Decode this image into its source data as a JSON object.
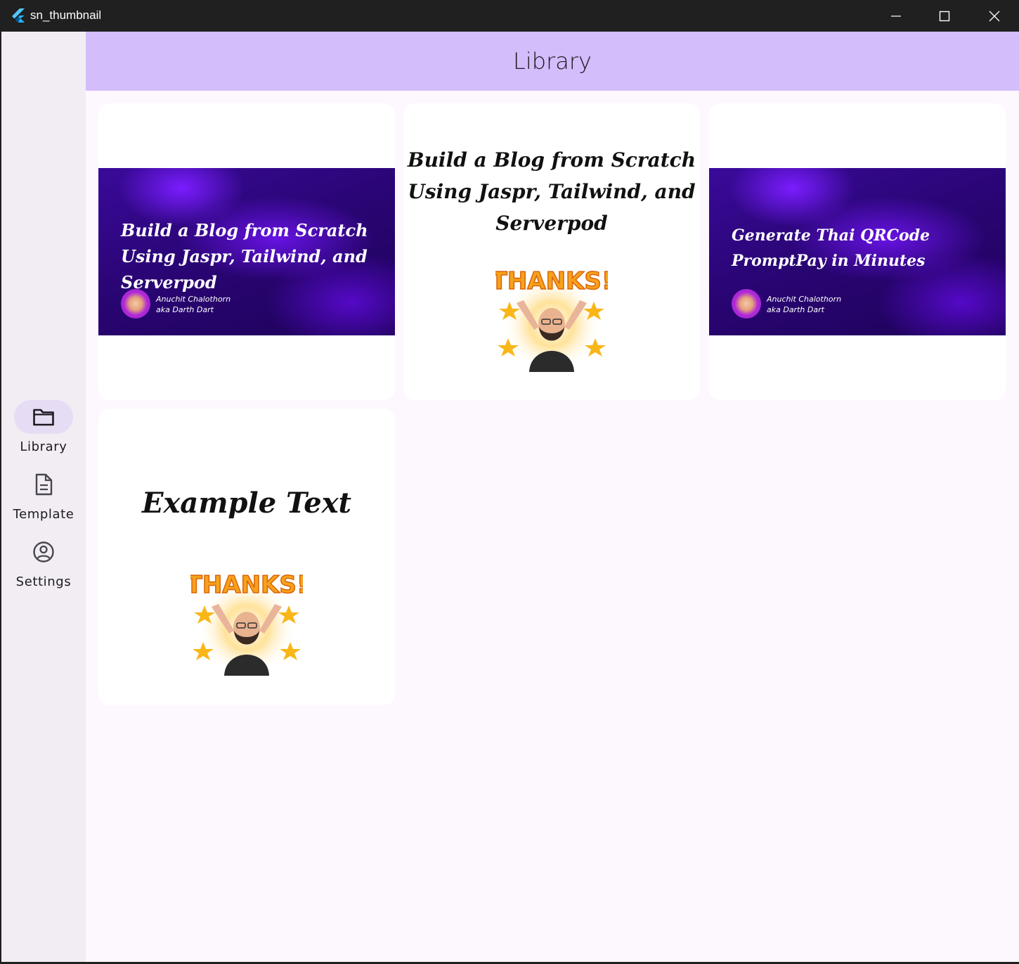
{
  "window": {
    "title": "sn_thumbnail",
    "controls": [
      "minimize",
      "maximize",
      "close"
    ]
  },
  "rail": {
    "items": [
      {
        "label": "Library",
        "icon": "folder-icon",
        "active": true
      },
      {
        "label": "Template",
        "icon": "document-icon",
        "active": false
      },
      {
        "label": "Settings",
        "icon": "account-circle-icon",
        "active": false
      }
    ]
  },
  "appbar": {
    "title": "Library"
  },
  "cards": [
    {
      "type": "banner",
      "title": "Build a Blog from Scratch Using Jaspr, Tailwind, and Serverpod",
      "author_name": "Anuchit Chalothorn",
      "author_aka": "aka Darth Dart"
    },
    {
      "type": "text-sticker",
      "title": "Build a Blog from Scratch Using Jaspr, Tailwind, and Serverpod",
      "sticker": "thanks-sticker"
    },
    {
      "type": "banner",
      "title": "Generate Thai QRCode PromptPay in Minutes",
      "author_name": "Anuchit Chalothorn",
      "author_aka": "aka Darth Dart"
    },
    {
      "type": "text-sticker",
      "title": "Example Text",
      "sticker": "thanks-sticker"
    }
  ],
  "colors": {
    "appbar_bg": "#d3bdfb",
    "rail_bg": "#f1edf3",
    "rail_active_indicator": "#e6dcf4",
    "content_bg": "#fdf7fe",
    "banner_purple": "#2a0575"
  }
}
